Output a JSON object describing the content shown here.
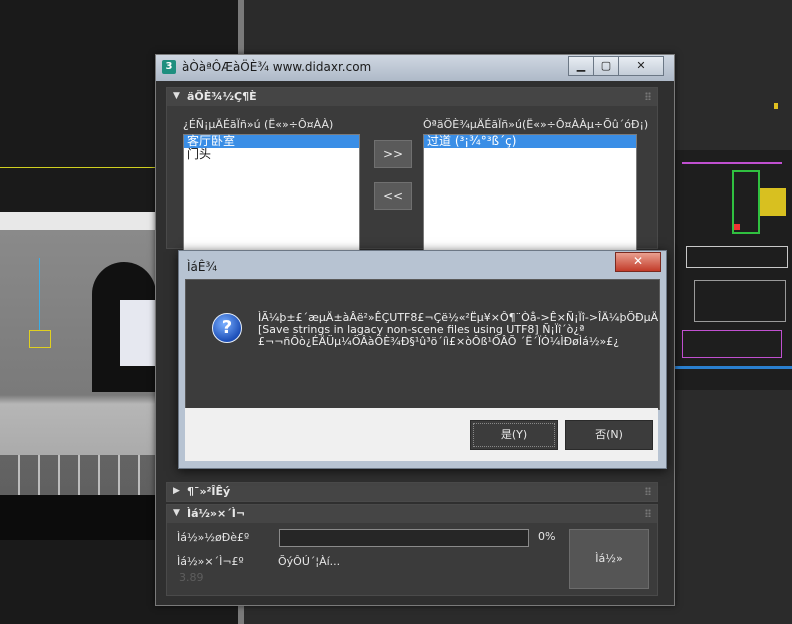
{
  "tool_window": {
    "title": "àÒàªÔÆàÖÈ¾ www.didaxr.com",
    "app_icon_glyph": "3",
    "controls": {
      "minimize": "▁",
      "maximize": "▢",
      "close": "✕"
    },
    "rollout1": {
      "title": "äÖÈ¾½Ç¶È",
      "left_label": "¿ÉÑ¡µÄÉãÏñ»ú (Ë«»÷Ô¤ÀÀ)",
      "right_label": "ÒªäÖÈ¾µÄÉãÏñ»ú(Ë«»÷Ô¤ÀÀµ÷Õû´óÐ¡)",
      "left_items": [
        "客厅卧室",
        "门头"
      ],
      "right_items": [
        "过道 (³¡¾°³ß´ç)"
      ],
      "add_button": ">>",
      "remove_button": "<<"
    },
    "rollout2": {
      "title": "¶¯»²ÎÊý"
    },
    "rollout3": {
      "title": "Ìá½»×´Ì¬",
      "progress_label": "Ìá½»½øÐè£º",
      "progress_value": 0,
      "progress_text": "0%",
      "status_label": "Ìá½»×´Ì¬£º",
      "status_value": "ÕýÔÚ´¦Àí...",
      "faint_value": "3.89",
      "submit_button": "Ìá½»"
    }
  },
  "dialog": {
    "title": "ÌáÊ¾",
    "close_glyph": "✕",
    "icon_glyph": "?",
    "message_lines": [
      "ÌÃ¼þ±£´æµÄ±àÂë²»ÊÇUTF8£¬Çë½«²Ëµ¥×Ô¶¨Òå->Ê×Ñ¡Ïî->ÎÄ¼þÖÐµÄ",
      "[Save strings in lagacy non-scene files using UTF8] Ñ¡Ïî´ò¿ª",
      "£¬¬ñÔò¿ÉÄÜµ¼ÖÂàÖÈ¾Ð§¹û³ö´íì£×òÔß¹ÔÂÕ ´Ë´ÏÓ¼ÌÐøÌá½»£¿"
    ],
    "yes_button": "是(Y)",
    "no_button": "否(N)"
  }
}
